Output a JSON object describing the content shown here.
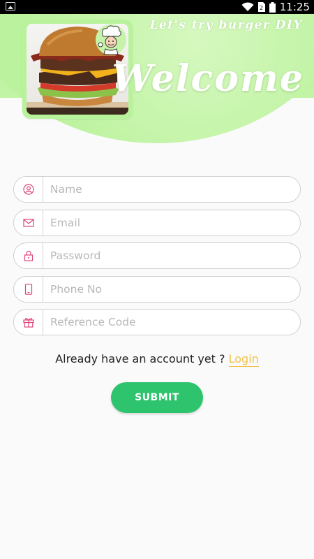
{
  "status_bar": {
    "time": "11:25",
    "icons": [
      "image-icon",
      "wifi-icon",
      "sim-icon",
      "battery-icon"
    ]
  },
  "header": {
    "tagline": "Let's try burger DIY",
    "welcome": "Welcome"
  },
  "form": {
    "fields": [
      {
        "placeholder": "Name",
        "icon": "user-icon"
      },
      {
        "placeholder": "Email",
        "icon": "mail-icon"
      },
      {
        "placeholder": "Password",
        "icon": "lock-icon"
      },
      {
        "placeholder": "Phone No",
        "icon": "phone-icon"
      },
      {
        "placeholder": "Reference Code",
        "icon": "gift-icon"
      }
    ],
    "login_prompt": "Already have an account yet ?",
    "login_link": "Login",
    "submit_label": "SUBMIT"
  },
  "colors": {
    "header_green": "#b4f095",
    "icon_pink": "#e0457b",
    "link_yellow": "#f0c24a",
    "submit_green": "#2ec36d"
  }
}
